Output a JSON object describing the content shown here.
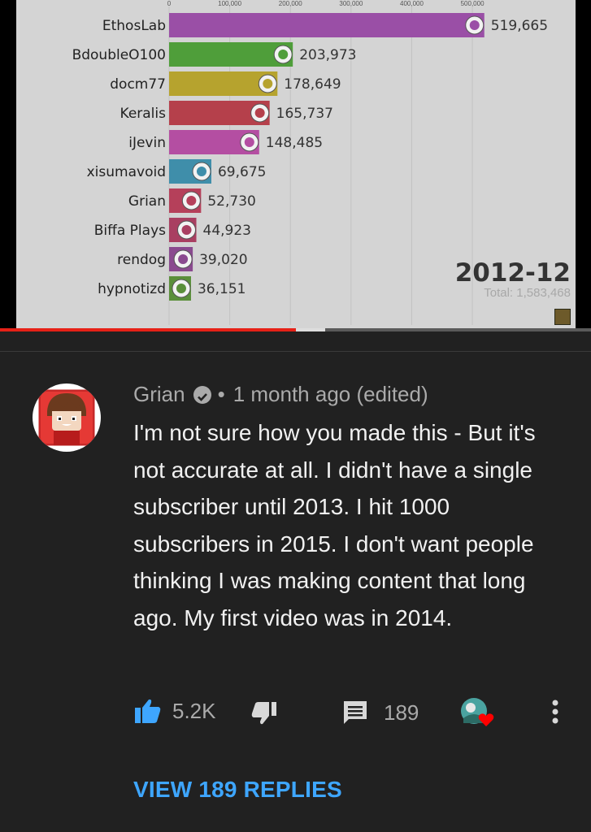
{
  "video": {
    "chart_data": {
      "type": "bar",
      "orientation": "horizontal",
      "categories": [
        "EthosLab",
        "BdoubleO100",
        "docm77",
        "Keralis",
        "iJevin",
        "xisumavoid",
        "Grian",
        "Biffa Plays",
        "rendog",
        "hypnotizd"
      ],
      "values": [
        519665,
        203973,
        178649,
        165737,
        148485,
        69675,
        52730,
        44923,
        39020,
        36151
      ],
      "value_labels": [
        "519,665",
        "203,973",
        "178,649",
        "165,737",
        "148,485",
        "69,675",
        "52,730",
        "44,923",
        "39,020",
        "36,151"
      ],
      "colors": [
        "#9a4fa6",
        "#4f9e3a",
        "#b6a32e",
        "#b5404b",
        "#b44ea2",
        "#3f8eaa",
        "#b5405a",
        "#a93f61",
        "#8a4a8f",
        "#5a8f3a"
      ],
      "x_ticks": [
        0,
        100000,
        200000,
        300000,
        400000,
        500000
      ],
      "x_tick_labels": [
        "0",
        "100,000",
        "200,000",
        "300,000",
        "400,000",
        "500,000"
      ],
      "xlim": [
        0,
        520000
      ],
      "grid": true,
      "date_label": "2012-12",
      "total_label": "Total: 1,583,468"
    },
    "progress": 0.5,
    "buffered": 0.55
  },
  "comment": {
    "author": "Grian",
    "separator": "•",
    "time": "1 month ago (edited)",
    "text": "I'm not sure how you made this - But it's not accurate at all. I didn't have a single subscriber until 2013. I hit 1000 subscribers in 2015. I don't want people thinking I was making content that long ago. My first video was in 2014.",
    "likes": "5.2K",
    "reply_count": "189",
    "view_replies": "VIEW 189 REPLIES",
    "icons": {
      "like": "thumbs-up-icon",
      "dislike": "thumbs-down-icon",
      "reply": "comment-icon",
      "heart": "creator-heart-icon",
      "more": "more-vert-icon"
    },
    "accent_color": "#3ea6ff",
    "heart_color": "#ff0000"
  }
}
